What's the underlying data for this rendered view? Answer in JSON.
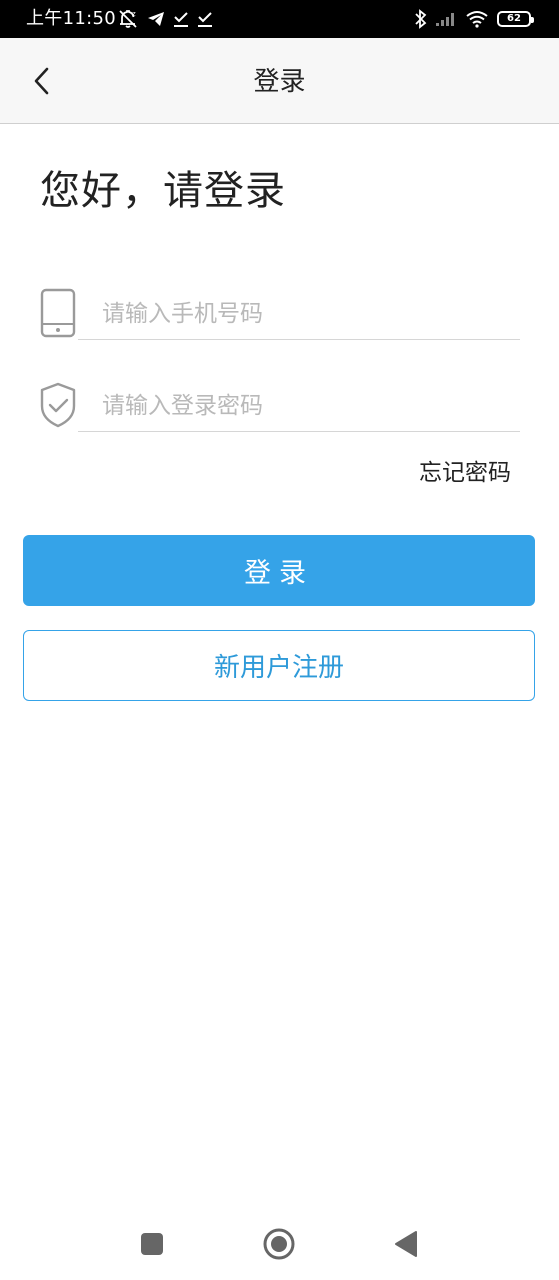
{
  "status_bar": {
    "time": "上午11:50",
    "battery_level": "62",
    "icons": [
      "alarm-off-icon",
      "telegram-icon",
      "download-done-icon",
      "download-done-icon",
      "bluetooth-icon",
      "signal-icon",
      "wifi-icon",
      "battery-icon"
    ]
  },
  "header": {
    "title": "登录",
    "back_icon": "chevron-left-icon"
  },
  "main": {
    "greeting": "您好，请登录",
    "phone_field": {
      "placeholder": "请输入手机号码",
      "value": "",
      "icon": "phone-icon"
    },
    "password_field": {
      "placeholder": "请输入登录密码",
      "value": "",
      "icon": "shield-check-icon"
    },
    "forgot_password": "忘记密码",
    "login_button": "登录",
    "register_button": "新用户注册"
  },
  "nav_bar": {
    "icons": [
      "square-recents-icon",
      "circle-home-icon",
      "triangle-back-icon"
    ]
  },
  "colors": {
    "accent": "#35a3e8",
    "header_bg": "#f7f7f7",
    "placeholder": "#b9b9b9"
  }
}
